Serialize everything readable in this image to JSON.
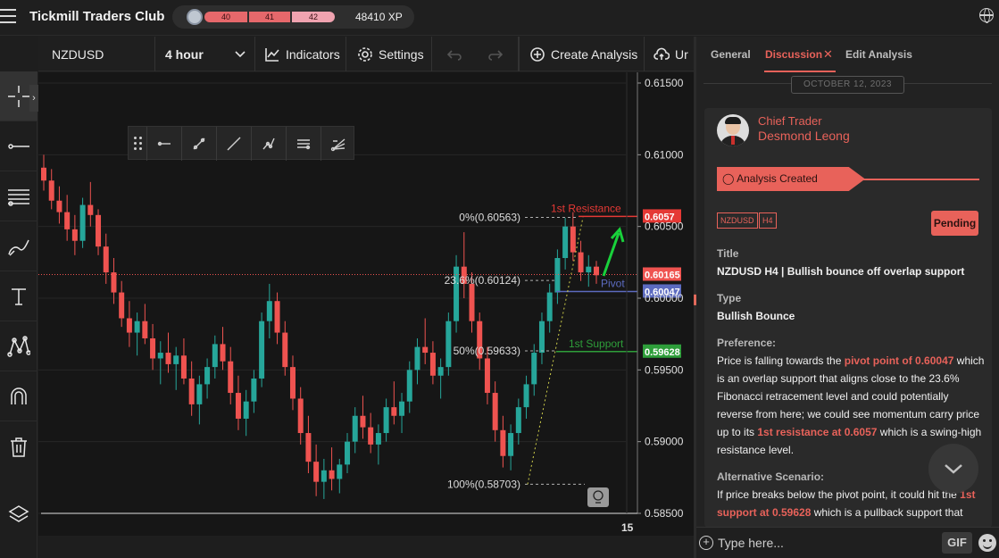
{
  "app": {
    "title": "Tickmill Traders Club",
    "levels": [
      "40",
      "41",
      "42"
    ],
    "xp": "48410 XP"
  },
  "toolbar": {
    "symbol": "NZDUSD",
    "timeframe": "4 hour",
    "indicators": "Indicators",
    "settings": "Settings",
    "create_analysis": "Create Analysis",
    "upload": "Ur"
  },
  "chart": {
    "price_axis": [
      "0.61500",
      "0.61000",
      "0.60500",
      "0.60000",
      "0.59500",
      "0.59000",
      "0.58500"
    ],
    "x_tick": "15",
    "fib_labels": [
      "0%(0.60563)",
      "23.6%(0.60124)",
      "50%(0.59633)",
      "100%(0.58703)"
    ],
    "lines": {
      "resistance": "1st Resistance",
      "pivot": "Pivot",
      "support": "1st Support"
    },
    "tags": {
      "resistance": "0.6057",
      "current": "0.60165",
      "pivot": "0.60047",
      "support": "0.59628"
    },
    "colors": {
      "up": "#26a69a",
      "down": "#ef5350",
      "resistance": "#e53935",
      "pivot": "#5c6bc0",
      "support": "#2e9e3a",
      "arrow": "#19d13b"
    },
    "candles": [
      [
        0.6091,
        0.61,
        0.6075,
        0.6082
      ],
      [
        0.6082,
        0.609,
        0.6062,
        0.6068
      ],
      [
        0.6068,
        0.6078,
        0.6052,
        0.606
      ],
      [
        0.606,
        0.6072,
        0.604,
        0.6048
      ],
      [
        0.6048,
        0.6058,
        0.603,
        0.604
      ],
      [
        0.604,
        0.607,
        0.6035,
        0.6065
      ],
      [
        0.6065,
        0.6081,
        0.605,
        0.6058
      ],
      [
        0.6058,
        0.6062,
        0.603,
        0.6036
      ],
      [
        0.6036,
        0.6045,
        0.601,
        0.6018
      ],
      [
        0.6018,
        0.6028,
        0.5996,
        0.6004
      ],
      [
        0.6004,
        0.6012,
        0.598,
        0.5986
      ],
      [
        0.5986,
        0.5998,
        0.5966,
        0.5976
      ],
      [
        0.5976,
        0.599,
        0.596,
        0.5984
      ],
      [
        0.5984,
        0.5996,
        0.5968,
        0.5972
      ],
      [
        0.5972,
        0.5982,
        0.595,
        0.5958
      ],
      [
        0.5958,
        0.597,
        0.594,
        0.5962
      ],
      [
        0.5962,
        0.5976,
        0.5948,
        0.5954
      ],
      [
        0.5954,
        0.5966,
        0.5936,
        0.596
      ],
      [
        0.596,
        0.5972,
        0.594,
        0.5944
      ],
      [
        0.5944,
        0.5956,
        0.5918,
        0.5926
      ],
      [
        0.5926,
        0.5946,
        0.5912,
        0.594
      ],
      [
        0.594,
        0.5958,
        0.593,
        0.5952
      ],
      [
        0.5952,
        0.5974,
        0.5944,
        0.5968
      ],
      [
        0.5968,
        0.598,
        0.595,
        0.5956
      ],
      [
        0.5956,
        0.5966,
        0.5926,
        0.5934
      ],
      [
        0.5934,
        0.5946,
        0.5908,
        0.5916
      ],
      [
        0.5916,
        0.5936,
        0.5904,
        0.5928
      ],
      [
        0.5928,
        0.595,
        0.592,
        0.5944
      ],
      [
        0.5944,
        0.599,
        0.5938,
        0.5984
      ],
      [
        0.5984,
        0.601,
        0.5972,
        0.5998
      ],
      [
        0.5998,
        0.6004,
        0.5968,
        0.5976
      ],
      [
        0.5976,
        0.5984,
        0.5946,
        0.5952
      ],
      [
        0.5952,
        0.596,
        0.5922,
        0.593
      ],
      [
        0.593,
        0.5938,
        0.5898,
        0.5906
      ],
      [
        0.5906,
        0.5918,
        0.5878,
        0.5886
      ],
      [
        0.5886,
        0.5898,
        0.5862,
        0.5872
      ],
      [
        0.5872,
        0.5888,
        0.586,
        0.588
      ],
      [
        0.588,
        0.5896,
        0.5866,
        0.5874
      ],
      [
        0.5874,
        0.5888,
        0.5864,
        0.5884
      ],
      [
        0.5884,
        0.5906,
        0.5878,
        0.59
      ],
      [
        0.59,
        0.5924,
        0.5892,
        0.5918
      ],
      [
        0.5918,
        0.5932,
        0.5902,
        0.591
      ],
      [
        0.591,
        0.592,
        0.5892,
        0.5898
      ],
      [
        0.5898,
        0.5912,
        0.5884,
        0.5906
      ],
      [
        0.5906,
        0.593,
        0.59,
        0.5924
      ],
      [
        0.5924,
        0.5942,
        0.5912,
        0.5918
      ],
      [
        0.5918,
        0.5934,
        0.5906,
        0.5928
      ],
      [
        0.5928,
        0.5956,
        0.592,
        0.595
      ],
      [
        0.595,
        0.5972,
        0.594,
        0.5966
      ],
      [
        0.5966,
        0.5986,
        0.5954,
        0.5962
      ],
      [
        0.5962,
        0.597,
        0.594,
        0.5946
      ],
      [
        0.5946,
        0.5958,
        0.593,
        0.5952
      ],
      [
        0.5952,
        0.599,
        0.5946,
        0.5984
      ],
      [
        0.5984,
        0.603,
        0.5976,
        0.6022
      ],
      [
        0.6022,
        0.6046,
        0.6,
        0.601
      ],
      [
        0.601,
        0.6018,
        0.5976,
        0.5984
      ],
      [
        0.5984,
        0.599,
        0.595,
        0.5958
      ],
      [
        0.5958,
        0.5966,
        0.5926,
        0.5934
      ],
      [
        0.5934,
        0.5942,
        0.59,
        0.5908
      ],
      [
        0.5908,
        0.5918,
        0.5882,
        0.589
      ],
      [
        0.589,
        0.5912,
        0.588,
        0.5906
      ],
      [
        0.5906,
        0.593,
        0.5898,
        0.5924
      ],
      [
        0.5924,
        0.5946,
        0.5916,
        0.594
      ],
      [
        0.594,
        0.5968,
        0.5932,
        0.5962
      ],
      [
        0.5962,
        0.599,
        0.5954,
        0.5984
      ],
      [
        0.5984,
        0.601,
        0.5976,
        0.6004
      ],
      [
        0.6004,
        0.6034,
        0.5996,
        0.6028
      ],
      [
        0.6028,
        0.6056,
        0.602,
        0.605
      ],
      [
        0.605,
        0.606,
        0.6026,
        0.6032
      ],
      [
        0.6032,
        0.604,
        0.6012,
        0.6018
      ],
      [
        0.6018,
        0.603,
        0.6008,
        0.6022
      ],
      [
        0.6022,
        0.6026,
        0.601,
        0.6016
      ]
    ]
  },
  "rail_tools": [
    "crosshair",
    "horizontal-line",
    "fib-levels",
    "brush",
    "text",
    "pattern",
    "magnet",
    "trash",
    "layers"
  ],
  "panel": {
    "tabs": [
      "General",
      "Discussion",
      "Edit Analysis"
    ],
    "date": "OCTOBER 12, 2023",
    "author_role": "Chief Trader",
    "author_name": "Desmond Leong",
    "banner": "Analysis Created",
    "tags": [
      "NZDUSD",
      "H4"
    ],
    "status": "Pending",
    "title_label": "Title",
    "title": "NZDUSD H4 | Bullish bounce off overlap support",
    "type_label": "Type",
    "type": "Bullish Bounce",
    "pref_label": "Preference:",
    "pref_1": "Price is falling towards the ",
    "pref_hl1": "pivot point of 0.60047",
    "pref_2": " which is an overlap support that aligns close to the 23.6% Fibonacci retracement level and could potentially reverse from here; we could see momentum carry price up to its ",
    "pref_hl2": "1st resistance at 0.6057",
    "pref_3": " which is a swing-high resistance level.",
    "alt_label": "Alternative Scenario:",
    "alt_1": "If price breaks below the pivot point, it could hit the ",
    "alt_hl1": "1st support at 0.59628",
    "alt_2": " which is a pullback support that",
    "composer_placeholder": "Type here...",
    "gif": "GIF",
    "accent": "#e8625a"
  }
}
